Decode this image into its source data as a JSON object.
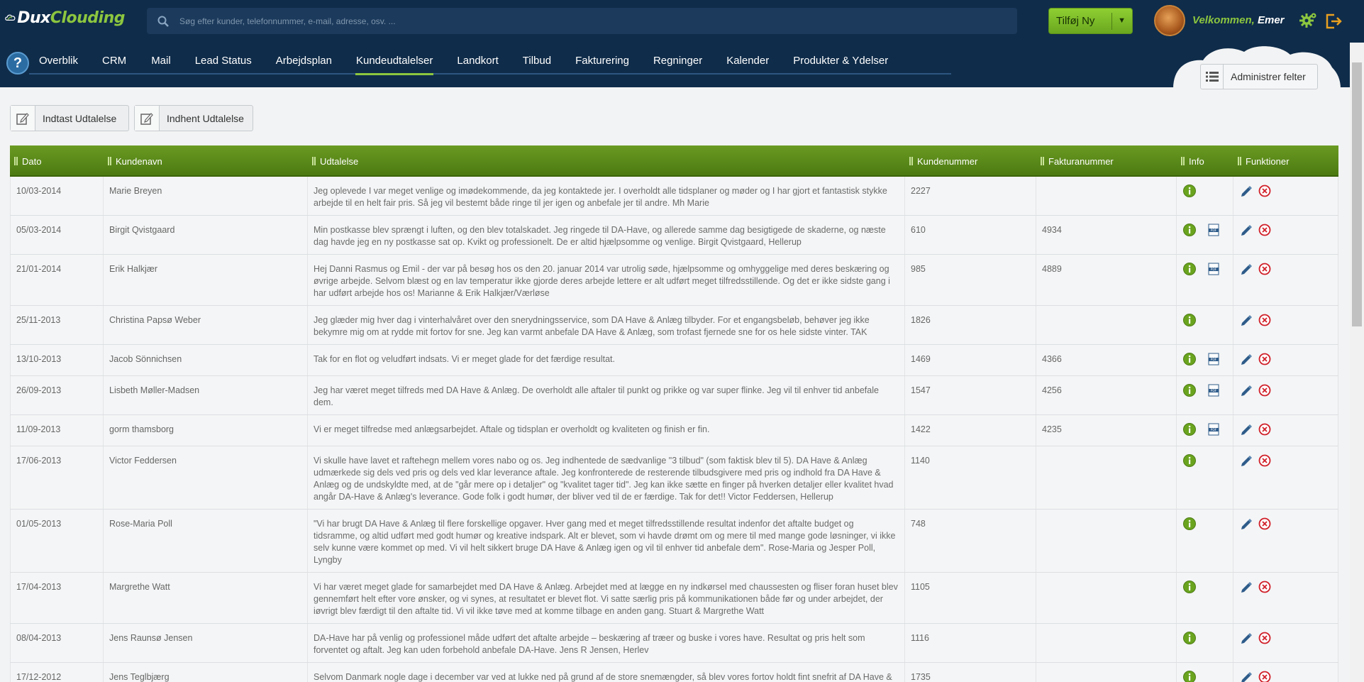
{
  "brand": {
    "logo_text_1": "Dux",
    "logo_text_2": "Clouding"
  },
  "search": {
    "placeholder": "Søg efter kunder, telefonnummer, e-mail, adresse, osv. ..."
  },
  "header": {
    "add_new_label": "Tilføj Ny",
    "welcome_prefix": "Velkommen,",
    "user_name": "Emer"
  },
  "nav": {
    "help_label": "?",
    "items": [
      {
        "label": "Overblik"
      },
      {
        "label": "CRM"
      },
      {
        "label": "Mail"
      },
      {
        "label": "Lead Status"
      },
      {
        "label": "Arbejdsplan"
      },
      {
        "label": "Kundeudtalelser"
      },
      {
        "label": "Landkort"
      },
      {
        "label": "Tilbud"
      },
      {
        "label": "Fakturering"
      },
      {
        "label": "Regninger"
      },
      {
        "label": "Kalender"
      },
      {
        "label": "Produkter & Ydelser"
      }
    ],
    "active_index": 5
  },
  "toolbar": {
    "admin_fields_label": "Administrer felter",
    "enter_statement_label": "Indtast Udtalelse",
    "fetch_statement_label": "Indhent Udtalelse"
  },
  "table": {
    "columns": [
      "Dato",
      "Kundenavn",
      "Udtalelse",
      "Kundenummer",
      "Fakturanummer",
      "Info",
      "Funktioner"
    ],
    "rows": [
      {
        "date": "10/03-2014",
        "name": "Marie Breyen",
        "statement": "Jeg oplevede I var meget venlige og imødekommende, da jeg kontaktede jer. I overholdt alle tidsplaner og møder og I har gjort et fantastisk stykke arbejde til en helt fair pris. Så jeg vil bestemt både ringe til jer igen og anbefale jer til andre. Mh Marie",
        "customer_no": "2227",
        "invoice_no": "",
        "pdf": false
      },
      {
        "date": "05/03-2014",
        "name": "Birgit Qvistgaard",
        "statement": "Min postkasse blev sprængt i luften, og den blev totalskadet. Jeg ringede til DA-Have, og allerede samme dag besigtigede de skaderne, og næste dag havde jeg en ny postkasse sat op. Kvikt og professionelt. De er altid hjælpsomme og venlige. Birgit Qvistgaard, Hellerup",
        "customer_no": "610",
        "invoice_no": "4934",
        "pdf": true
      },
      {
        "date": "21/01-2014",
        "name": "Erik Halkjær",
        "statement": "Hej Danni Rasmus og Emil - der var på besøg hos os den 20. januar 2014 var utrolig søde, hjælpsomme og omhyggelige med deres beskæring og øvrige arbejde. Selvom blæst og en lav temperatur ikke gjorde deres arbejde lettere er alt udført meget tilfredsstillende. Og det er ikke sidste gang i har udført arbejde hos os! Marianne & Erik Halkjær/Værløse",
        "customer_no": "985",
        "invoice_no": "4889",
        "pdf": true
      },
      {
        "date": "25/11-2013",
        "name": "Christina Papsø Weber",
        "statement": "Jeg glæder mig hver dag i vinterhalvåret over den snerydningsservice, som DA Have & Anlæg tilbyder. For et engangsbeløb, behøver jeg ikke bekymre mig om at rydde mit fortov for sne. Jeg kan varmt anbefale DA Have & Anlæg, som trofast fjernede sne for os hele sidste vinter. TAK",
        "customer_no": "1826",
        "invoice_no": "",
        "pdf": false
      },
      {
        "date": "13/10-2013",
        "name": "Jacob Sönnichsen",
        "statement": "Tak for en flot og veludført indsats. Vi er meget glade for det færdige resultat.",
        "customer_no": "1469",
        "invoice_no": "4366",
        "pdf": true
      },
      {
        "date": "26/09-2013",
        "name": "Lisbeth Møller-Madsen",
        "statement": "Jeg har været meget tilfreds med DA Have & Anlæg. De overholdt alle aftaler til punkt og prikke og var super flinke. Jeg vil til enhver tid anbefale dem.",
        "customer_no": "1547",
        "invoice_no": "4256",
        "pdf": true
      },
      {
        "date": "11/09-2013",
        "name": "gorm thamsborg",
        "statement": "Vi er meget tilfredse med anlægsarbejdet. Aftale og tidsplan er overholdt og kvaliteten og finish er fin.",
        "customer_no": "1422",
        "invoice_no": "4235",
        "pdf": true
      },
      {
        "date": "17/06-2013",
        "name": "Victor Feddersen",
        "statement": "Vi skulle have lavet et raftehegn mellem vores nabo og os. Jeg indhentede de sædvanlige \"3 tilbud\" (som faktisk blev til 5). DA Have & Anlæg udmærkede sig dels ved pris og dels ved klar leverance aftale. Jeg konfronterede de resterende tilbudsgivere med pris og indhold fra DA Have & Anlæg og de undskyldte med, at de \"går mere op i detaljer\" og \"kvalitet tager tid\". Jeg kan ikke sætte en finger på hverken detaljer eller kvalitet hvad angår DA-Have & Anlæg's leverance. Gode folk i godt humør, der bliver ved til de er færdige. Tak for det!! Victor Feddersen, Hellerup",
        "customer_no": "1140",
        "invoice_no": "",
        "pdf": false
      },
      {
        "date": "01/05-2013",
        "name": "Rose-Maria Poll",
        "statement": "\"Vi har brugt DA Have & Anlæg til flere forskellige opgaver. Hver gang med et meget tilfredsstillende resultat indenfor det aftalte budget og tidsramme, og altid udført med godt humør og kreative indspark. Alt er blevet, som vi havde drømt om og mere til med mange gode løsninger, vi ikke selv kunne være kommet op med. Vi vil helt sikkert bruge DA Have & Anlæg igen og vil til enhver tid anbefale dem\". Rose-Maria og Jesper Poll, Lyngby",
        "customer_no": "748",
        "invoice_no": "",
        "pdf": false
      },
      {
        "date": "17/04-2013",
        "name": "Margrethe Watt",
        "statement": "Vi har været meget glade for samarbejdet med DA Have & Anlæg. Arbejdet med at lægge en ny indkørsel med chaussesten og fliser foran huset blev gennemført helt efter vore ønsker, og vi synes, at resultatet er blevet flot. Vi satte særlig pris på kommunikationen både før og under arbejdet, der iøvrigt blev færdigt til den aftalte tid. Vi vil ikke tøve med at komme tilbage en anden gang. Stuart & Margrethe Watt",
        "customer_no": "1105",
        "invoice_no": "",
        "pdf": false
      },
      {
        "date": "08/04-2013",
        "name": "Jens Raunsø Jensen",
        "statement": "DA-Have har på venlig og professionel måde udført det aftalte arbejde – beskæring af træer og buske i vores have. Resultat og pris helt som forventet og aftalt. Jeg kan uden forbehold anbefale DA-Have. Jens R Jensen, Herlev",
        "customer_no": "1116",
        "invoice_no": "",
        "pdf": false
      },
      {
        "date": "17/12-2012",
        "name": "Jens Teglbjærg",
        "statement": "Selvom Danmark nogle dage i december var ved at lukke ned på grund af de store snemængder, så blev vores fortov holdt fint snefrit af DA Have & Anlæg. Hvad enten der er faldet et par eller ti centimeter sne, så har de har været omkring vores hus, og de af naboerne, der har været på",
        "customer_no": "1735",
        "invoice_no": "",
        "pdf": false
      }
    ]
  },
  "colors": {
    "topbar": "#0f2c4a",
    "accent_green": "#8cc63f",
    "table_header": "#5a8a1a",
    "delete_red": "#d0202a"
  }
}
